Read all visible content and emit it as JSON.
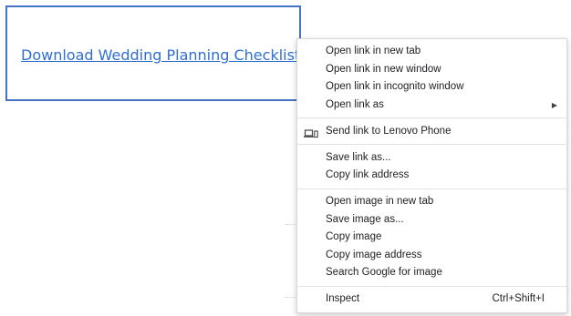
{
  "page": {
    "link_text": "Download Wedding Planning Checklist"
  },
  "context_menu": {
    "groups": [
      [
        {
          "label": "Open link in new tab"
        },
        {
          "label": "Open link in new window"
        },
        {
          "label": "Open link in incognito window"
        },
        {
          "label": "Open link as",
          "submenu": true
        }
      ],
      [
        {
          "label": "Send link to Lenovo Phone",
          "icon": "laptop-phone-icon"
        }
      ],
      [
        {
          "label": "Save link as..."
        },
        {
          "label": "Copy link address"
        }
      ],
      [
        {
          "label": "Open image in new tab"
        },
        {
          "label": "Save image as..."
        },
        {
          "label": "Copy image"
        },
        {
          "label": "Copy image address"
        },
        {
          "label": "Search Google for image"
        }
      ],
      [
        {
          "label": "Inspect",
          "shortcut": "Ctrl+Shift+I"
        }
      ]
    ]
  },
  "colors": {
    "link": "#2f6fd1",
    "box_border": "#4472c4",
    "menu_text": "#202124",
    "separator": "#e3e3e3"
  }
}
